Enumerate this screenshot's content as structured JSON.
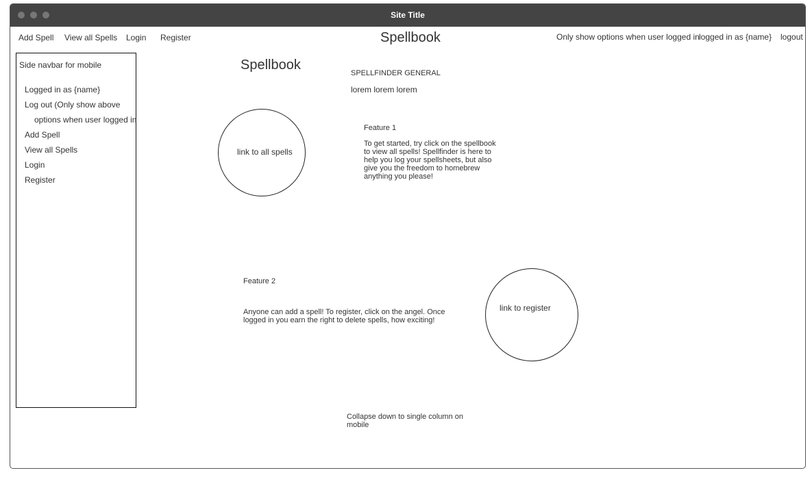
{
  "window": {
    "title": "Site Title"
  },
  "topnav": {
    "links": [
      "Add Spell",
      "View all Spells",
      "Login",
      "Register"
    ],
    "brand": "Spellbook",
    "right": [
      "Only show options when user logged in",
      "logged in as  {name}",
      "logout"
    ]
  },
  "sidebar": {
    "title": "Side navbar for mobile",
    "items": [
      "Logged in as {name}",
      "Log out (Only show above",
      "options when user logged in",
      "Add Spell",
      "View all Spells",
      "Login",
      "Register"
    ]
  },
  "main": {
    "heading": "Spellbook",
    "subtitle": "SPELLFINDER GENERAL",
    "lorem": "lorem lorem lorem",
    "circle1": "link to all spells",
    "feature1_title": "Feature 1",
    "feature1_text": "To get started, try click on the spellbook to view all spells! Spellfinder is here to help you log your spellsheets, but also give you the freedom to homebrew anything you please!",
    "feature2_title": "Feature 2",
    "feature2_text": "Anyone can add a spell! To register, click on the angel. Once logged in you earn the right to delete spells, how exciting!",
    "circle2": "link to register",
    "note": "Collapse down to single column on mobile"
  }
}
